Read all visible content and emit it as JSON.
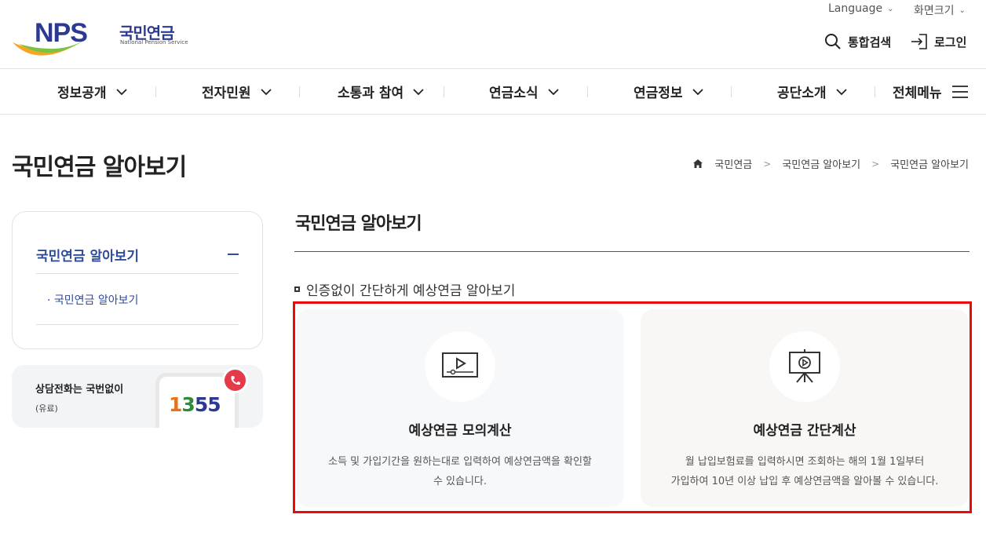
{
  "header": {
    "logo_text_en": "NPS",
    "logo_text_ko": "국민연금",
    "logo_sub": "National Pension Service",
    "language_label": "Language",
    "zoom_label": "화면크기",
    "search_label": "통합검색",
    "login_label": "로그인"
  },
  "gnb": {
    "items": [
      {
        "label": "정보공개"
      },
      {
        "label": "전자민원"
      },
      {
        "label": "소통과 참여"
      },
      {
        "label": "연금소식"
      },
      {
        "label": "연금정보"
      },
      {
        "label": "공단소개"
      }
    ],
    "all_menu_label": "전체메뉴"
  },
  "page": {
    "title": "국민연금 알아보기",
    "breadcrumb": [
      "국민연금",
      "국민연금 알아보기",
      "국민연금 알아보기"
    ]
  },
  "sidebar": {
    "heading": "국민연금 알아보기",
    "items": [
      {
        "label": "국민연금 알아보기"
      }
    ],
    "call": {
      "title": "상담전화는 국번없이",
      "sub": "(유료)",
      "number_digits": [
        "1",
        "3",
        "5",
        "5"
      ],
      "number_colors": [
        "#e8711c",
        "#2e8b3a",
        "#2b3990",
        "#2b3990"
      ]
    }
  },
  "main": {
    "title": "국민연금 알아보기",
    "section_title": "인증없이 간단하게 예상연금 알아보기",
    "cards": [
      {
        "icon": "video-player-icon",
        "title": "예상연금 모의계산",
        "desc_line1": "소득 및 가입기간을 원하는대로 입력하여 예상연금액을 확인할",
        "desc_line2": "수 있습니다."
      },
      {
        "icon": "presentation-board-icon",
        "title": "예상연금 간단계산",
        "desc_line1": "월 납입보험료를 입력하시면 조회하는 해의 1월 1일부터",
        "desc_line2": "가입하여 10년 이상 납입 후 예상연금액을 알아볼 수 있습니다."
      }
    ]
  },
  "colors": {
    "brand_navy": "#2b3990",
    "link_blue": "#2f4b9a",
    "highlight_red": "#ea0a0a",
    "call_red": "#e53a49"
  }
}
